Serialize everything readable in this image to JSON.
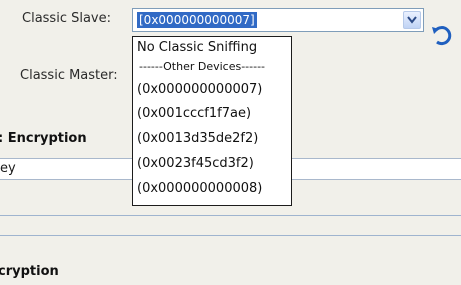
{
  "classic_slave": {
    "label": "Classic Slave:",
    "value": "[0x000000000007]"
  },
  "classic_master": {
    "label": "Classic Master:"
  },
  "dropdown": {
    "options": [
      "No Classic Sniffing",
      "------Other Devices------",
      "(0x000000000007)",
      "(0x001cccf1f7ae)",
      "(0x0013d35de2f2)",
      "(0x0023f45cd3f2)",
      "(0x000000000008)"
    ]
  },
  "sections": {
    "encryption_heading": ": Encryption",
    "key_text": "ey",
    "encryption_heading_2": "cryption"
  },
  "icons": {
    "refresh": "refresh-icon",
    "combo_arrow": "chevron-down-icon"
  },
  "colors": {
    "selection": "#316ac5",
    "refresh_icon": "#1f5fbf"
  }
}
